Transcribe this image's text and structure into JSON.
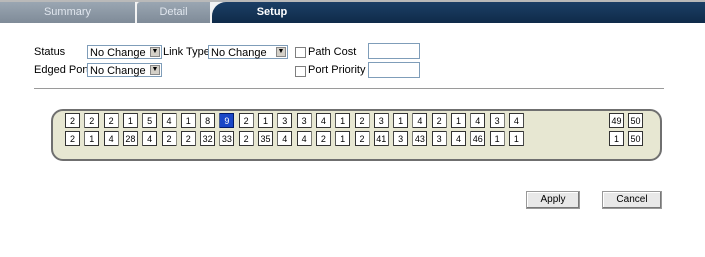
{
  "tabs": {
    "summary": "Summary",
    "detail": "Detail",
    "setup": "Setup"
  },
  "form": {
    "status_label": "Status",
    "status_value": "No Change",
    "link_type_label": "Link Type",
    "link_type_value": "No Change",
    "path_cost_label": "Path Cost",
    "path_cost_value": "",
    "edged_port_label": "Edged Port",
    "edged_port_value": "No Change",
    "port_priority_label": "Port Priority",
    "port_priority_value": ""
  },
  "ports": {
    "top_row": [
      "2",
      "2",
      "2",
      "1",
      "5",
      "4",
      "1",
      "8",
      "9",
      "2",
      "1",
      "3",
      "3",
      "4",
      "1",
      "2",
      "3",
      "1",
      "4",
      "2",
      "1",
      "4",
      "3",
      "4"
    ],
    "bottom_row": [
      "2",
      "1",
      "4",
      "28",
      "4",
      "2",
      "2",
      "32",
      "33",
      "2",
      "35",
      "4",
      "4",
      "2",
      "1",
      "2",
      "41",
      "3",
      "43",
      "3",
      "4",
      "46",
      "1",
      "1"
    ],
    "uplink_top": [
      "49",
      "50"
    ],
    "uplink_bottom": [
      "1",
      "50"
    ],
    "selected_index_top": 8
  },
  "buttons": {
    "apply": "Apply",
    "cancel": "Cancel"
  }
}
